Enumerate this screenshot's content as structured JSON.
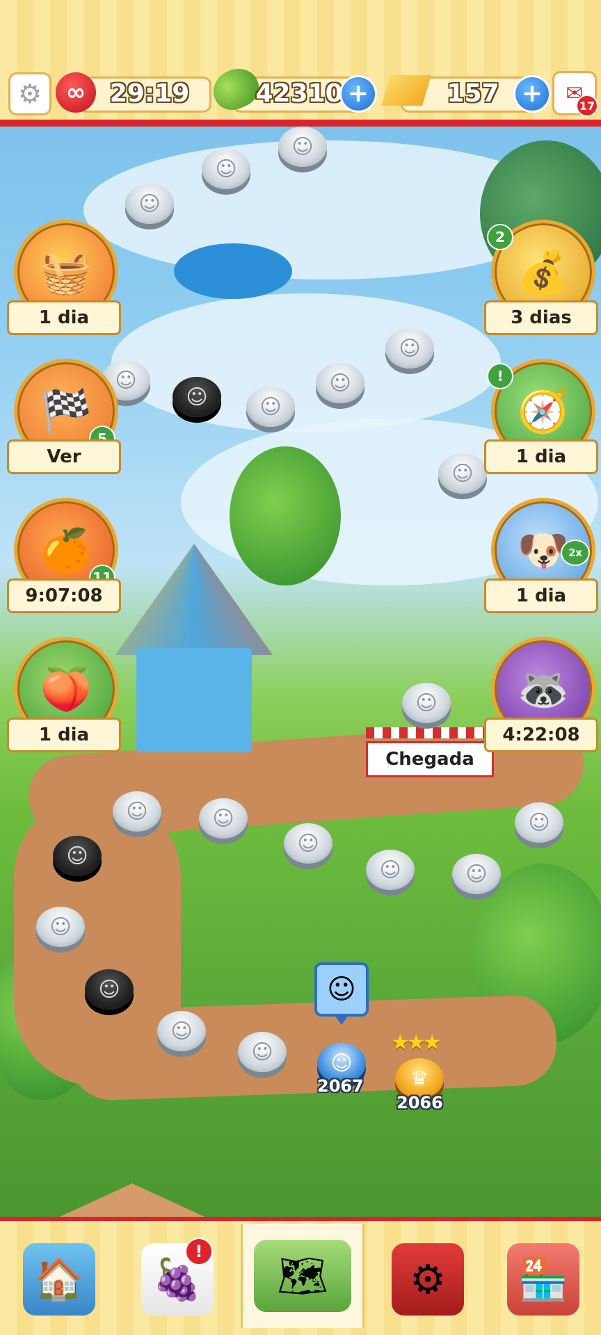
{
  "topbar": {
    "settings_icon": "gear-icon",
    "lives": {
      "icon": "infinite-lives-icon",
      "value": "29:19"
    },
    "beans": {
      "icon": "bean-icon",
      "value": "42310",
      "add_icon": "plus-icon"
    },
    "gold": {
      "icon": "gold-bar-icon",
      "value": "157",
      "add_icon": "plus-icon"
    },
    "inbox": {
      "icon": "mailbox-icon",
      "badge": "17"
    }
  },
  "left_events": [
    {
      "icon": "fruit-basket-icon",
      "label": "1 dia",
      "badge": ""
    },
    {
      "icon": "race-flag-icon",
      "label": "Ver",
      "badge": "5"
    },
    {
      "icon": "fruit-character-icon",
      "label": "9:07:08",
      "badge": "11"
    },
    {
      "icon": "rake-icon",
      "label": "1 dia",
      "badge": ""
    }
  ],
  "right_events": [
    {
      "icon": "gold-pile-icon",
      "label": "3 dias",
      "badge": "2"
    },
    {
      "icon": "compass-icon",
      "label": "1 dia",
      "badge": "!"
    },
    {
      "icon": "dog-icon",
      "label": "1 dia",
      "badge": "2x"
    },
    {
      "icon": "raccoon-icon",
      "label": "4:22:08",
      "badge": ""
    }
  ],
  "map": {
    "finish_label": "Chegada",
    "current_level": "2067",
    "completed_level": "2066",
    "completed_stars": "★★★",
    "player_avatar": "player-avatar-icon"
  },
  "bottom_nav": [
    {
      "icon": "barn-icon",
      "active": false,
      "alert": ""
    },
    {
      "icon": "calendar-fruit-icon",
      "active": false,
      "alert": "!"
    },
    {
      "icon": "map-icon",
      "active": true,
      "alert": ""
    },
    {
      "icon": "shield-gear-icon",
      "active": false,
      "alert": ""
    },
    {
      "icon": "shop-stand-icon",
      "active": false,
      "alert": ""
    }
  ],
  "colors": {
    "accent_red": "#d8242a",
    "gold_border": "#e4b14d",
    "blue_plus": "#1d6fd6"
  }
}
